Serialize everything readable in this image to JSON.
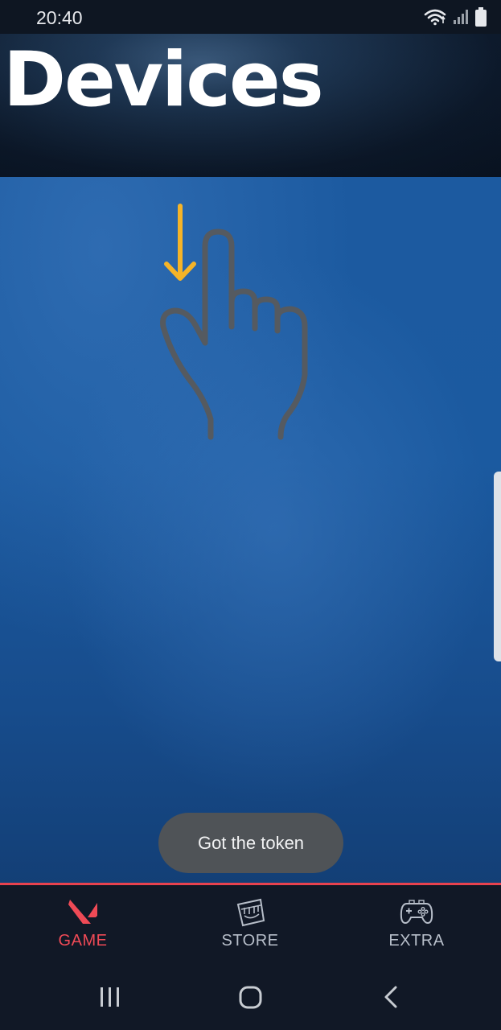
{
  "status_bar": {
    "time": "20:40",
    "icons": [
      "wifi-icon",
      "signal-icon",
      "battery-icon"
    ]
  },
  "header": {
    "title": "Devices"
  },
  "main": {
    "gesture_icon": "swipe-down-hand-icon",
    "arrow_color": "#f5b428"
  },
  "toast": {
    "message": "Got the token"
  },
  "bottom_nav": {
    "items": [
      {
        "label": "GAME",
        "icon": "valorant-logo-icon",
        "active": true
      },
      {
        "label": "STORE",
        "icon": "store-bag-icon",
        "active": false
      },
      {
        "label": "EXTRA",
        "icon": "gamepad-icon",
        "active": false
      }
    ],
    "accent_color": "#e8424f"
  },
  "system_nav": {
    "buttons": [
      "recent-apps-icon",
      "home-icon",
      "back-icon"
    ]
  }
}
